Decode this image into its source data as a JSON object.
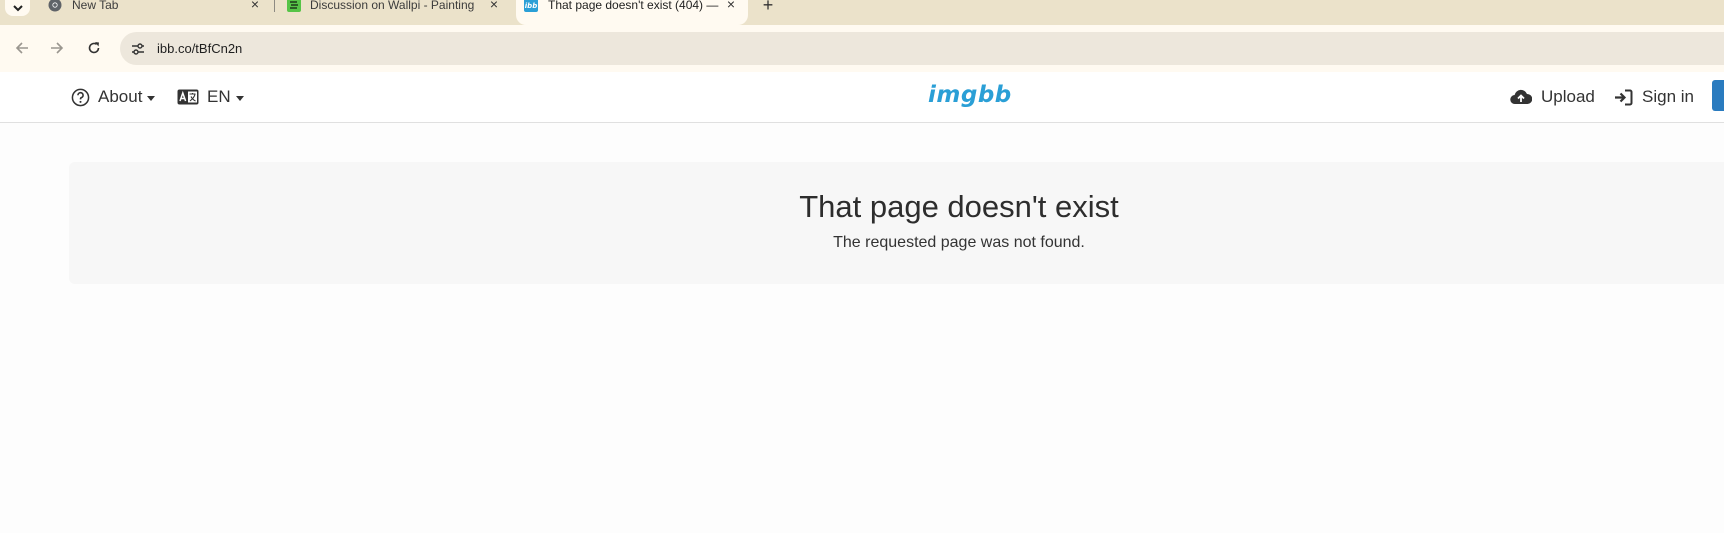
{
  "browser": {
    "tabs": [
      {
        "title": "New Tab"
      },
      {
        "title": "Discussion on Wallpi - Painting"
      },
      {
        "title": "That page doesn't exist (404) —"
      }
    ],
    "url": "ibb.co/tBfCn2n"
  },
  "header": {
    "about_label": "About",
    "language_label": "EN",
    "logo_text": "imgbb",
    "upload_label": "Upload",
    "signin_label": "Sign in"
  },
  "notice": {
    "title": "That page doesn't exist",
    "message": "The requested page was not found."
  },
  "colors": {
    "brand": "#2a9fd6",
    "tabstrip": "#ebe2ca",
    "toolbar": "#fffaf1",
    "omnibox": "#ede7dc",
    "button_primary": "#2a7bbf"
  }
}
